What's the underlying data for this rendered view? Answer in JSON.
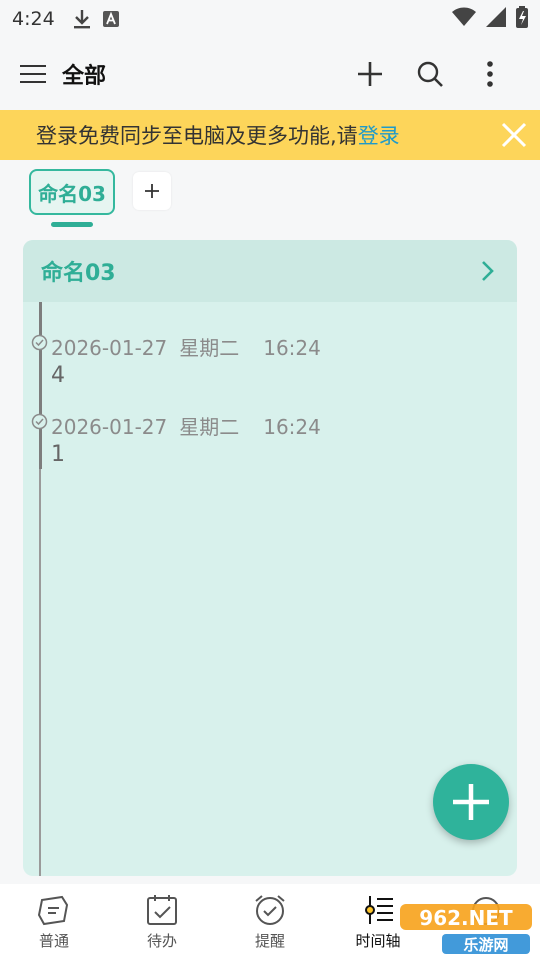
{
  "status_bar": {
    "time": "4:24"
  },
  "header": {
    "title": "全部"
  },
  "banner": {
    "text": "登录免费同步至电脑及更多功能,请",
    "link": "登录"
  },
  "tabs": {
    "active_label": "命名03",
    "add_symbol": "+"
  },
  "card": {
    "title": "命名03",
    "entries": [
      {
        "date": "2026-01-27",
        "weekday": "星期二",
        "time": "16:24",
        "text": "4"
      },
      {
        "date": "2026-01-27",
        "weekday": "星期二",
        "time": "16:24",
        "text": "1"
      }
    ]
  },
  "bottom_nav": [
    {
      "label": "普通",
      "icon": "note-icon"
    },
    {
      "label": "待办",
      "icon": "todo-calendar-icon"
    },
    {
      "label": "提醒",
      "icon": "alarm-clock-icon"
    },
    {
      "label": "时间轴",
      "icon": "timeline-icon"
    },
    {
      "label": "",
      "icon": "more-icon"
    }
  ],
  "watermark": {
    "text": "962.NET",
    "sub": "乐游网"
  },
  "colors": {
    "accent": "#2fae96",
    "banner": "#fdd55a",
    "link": "#1f9ac9",
    "card": "#d8f1ec"
  }
}
